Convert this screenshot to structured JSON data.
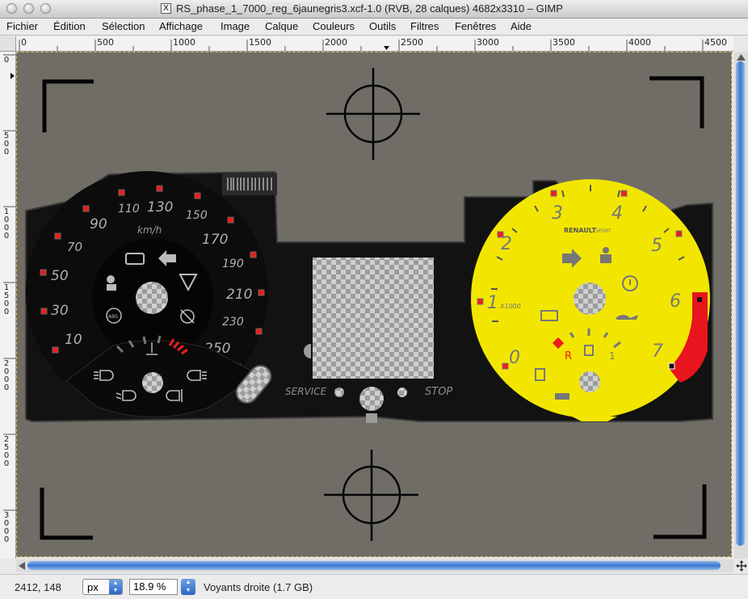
{
  "window": {
    "title": "RS_phase_1_7000_reg_6jaunegris3.xcf-1.0 (RVB, 28 calques) 4682x3310 – GIMP",
    "x_icon": "X"
  },
  "menu": [
    "Fichier",
    "Édition",
    "Sélection",
    "Affichage",
    "Image",
    "Calque",
    "Couleurs",
    "Outils",
    "Filtres",
    "Fenêtres",
    "Aide"
  ],
  "hruler_labels": [
    "0",
    "500",
    "1000",
    "1500",
    "2000",
    "2500",
    "3000",
    "3500",
    "4000",
    "4500"
  ],
  "vruler_labels": [
    "0",
    "500",
    "1000",
    "1500",
    "2000",
    "2500",
    "3000"
  ],
  "dashboard": {
    "speed_labels": [
      "10",
      "30",
      "50",
      "70",
      "90",
      "110",
      "130",
      "150",
      "170",
      "190",
      "210",
      "230",
      "250"
    ],
    "speed_unit": "km/h",
    "abs_label": "ABS",
    "service_label": "SERVICE",
    "stop_label": "STOP",
    "tach_labels": [
      "0",
      "1",
      "2",
      "3",
      "4",
      "5",
      "6",
      "7"
    ],
    "tach_multiplier": "X1000",
    "brand": "RENAULT",
    "brand_suffix": "SPORT",
    "gear_r": "R",
    "gear_1": "1",
    "tach_color": "#f2e600",
    "redline_color": "#e8141e"
  },
  "status": {
    "coords": "2412, 148",
    "unit": "px",
    "zoom": "18.9 %",
    "layer_info": "Voyants droite (1.7 GB)"
  },
  "colors": {
    "canvas_bg": "#6f6d66",
    "panel_bg": "#111111",
    "scroll_accent": "#3b78d1"
  }
}
